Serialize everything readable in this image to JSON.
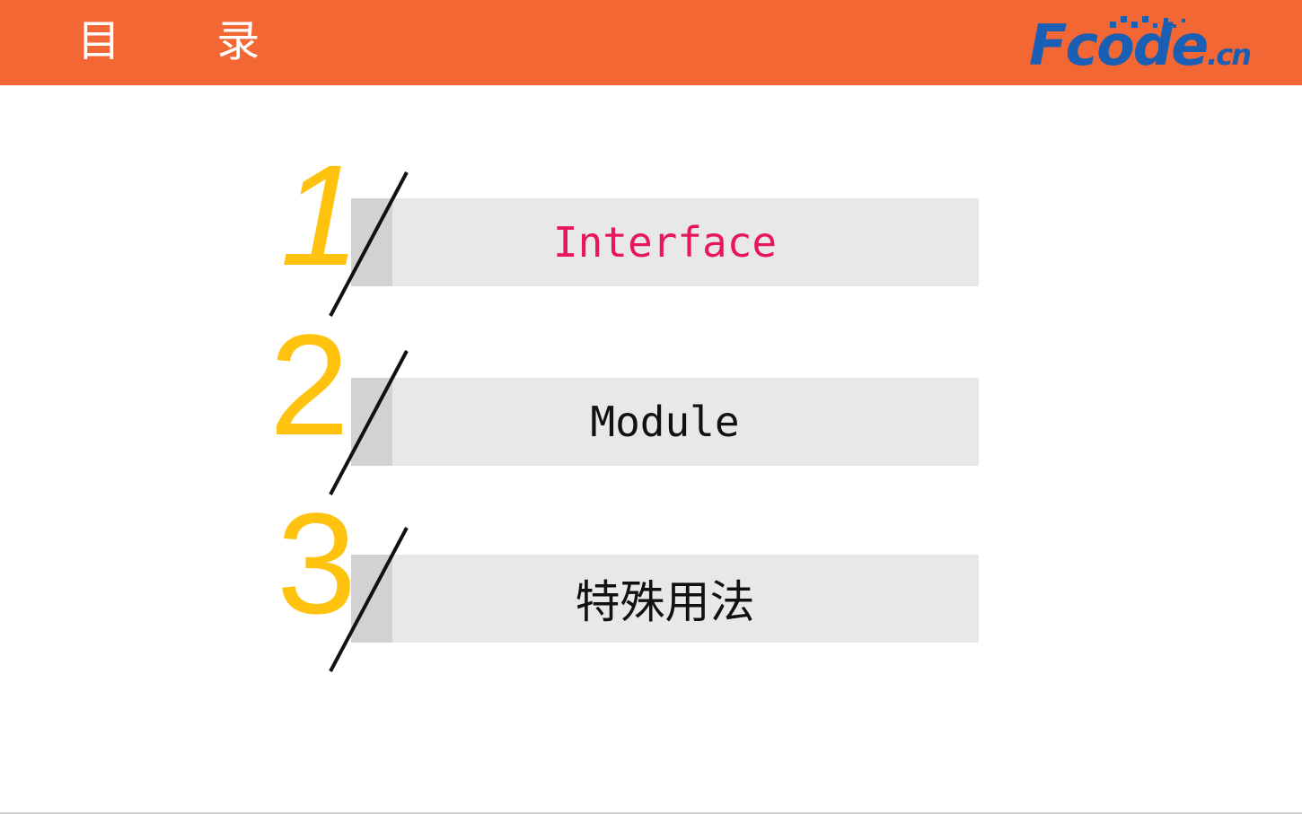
{
  "header": {
    "title": "目 录",
    "background_color": "#f26733",
    "title_color": "#ffffff"
  },
  "logo": {
    "text_main": "Fcode",
    "text_suffix": ".cn",
    "color": "#1a5fb4"
  },
  "toc": {
    "number_color": "#ffc20e",
    "items": [
      {
        "number": "1",
        "label": "Interface",
        "label_color": "#e8175d",
        "active": true
      },
      {
        "number": "2",
        "label": "Module",
        "label_color": "#111111",
        "active": false
      },
      {
        "number": "3",
        "label": "特殊用法",
        "label_color": "#111111",
        "active": false
      }
    ]
  }
}
